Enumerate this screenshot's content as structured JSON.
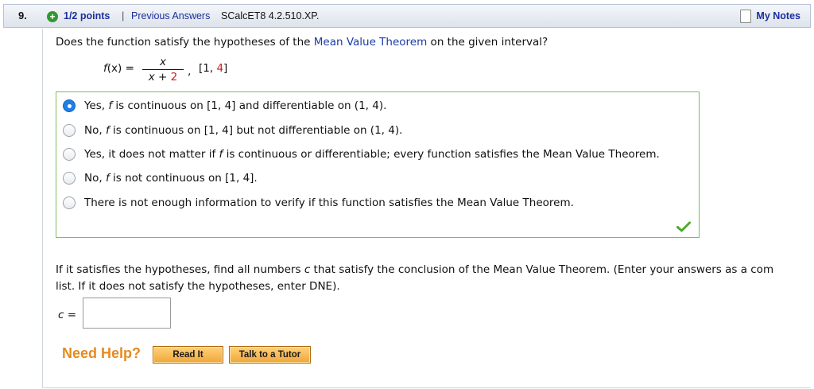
{
  "header": {
    "question_number": "9.",
    "points": "1/2 points",
    "separator": "|",
    "previous_answers": "Previous Answers",
    "problem_code": "SCalcET8 4.2.510.XP.",
    "my_notes": "My Notes"
  },
  "question": {
    "prefix": "Does the function satisfy the hypotheses of the ",
    "link": "Mean Value Theorem",
    "suffix": " on the given interval?"
  },
  "formula": {
    "lhs_f": "f",
    "lhs_rest": "(x) =",
    "numerator": "x",
    "den_var": "x",
    "den_plus": " + ",
    "den_const": "2",
    "comma": ",",
    "interval_open": "[1, ",
    "interval_end": "4",
    "interval_close": "]"
  },
  "choices": [
    {
      "pre": "Yes, ",
      "f": "f",
      "post": " is continuous on [1, 4] and differentiable on (1, 4).",
      "selected": true
    },
    {
      "pre": "No, ",
      "f": "f",
      "post": " is continuous on [1, 4] but not differentiable on (1, 4).",
      "selected": false
    },
    {
      "pre": "Yes, it does not matter if ",
      "f": "f",
      "post": " is continuous or differentiable; every function satisfies the Mean Value Theorem.",
      "selected": false
    },
    {
      "pre": "No, ",
      "f": "f",
      "post": " is not continuous on [1, 4].",
      "selected": false
    },
    {
      "pre": "There is not enough information to verify if this function satisfies the Mean Value Theorem.",
      "f": "",
      "post": "",
      "selected": false
    }
  ],
  "part2": {
    "line1_pre": "If it satisfies the hypotheses, find all numbers ",
    "line1_var": "c",
    "line1_post": " that satisfy the conclusion of the Mean Value Theorem. (Enter your answers as a com",
    "line2": "list. If it does not satisfy the hypotheses, enter DNE)."
  },
  "answer_field": {
    "label_var": "c",
    "label_eq": " =",
    "value": ""
  },
  "help": {
    "title": "Need Help?",
    "read_it": "Read It",
    "talk_to_tutor": "Talk to a Tutor"
  },
  "colors": {
    "link": "#1a2f9a",
    "correct_border": "#7bbd5c",
    "check": "#4caa2f",
    "help_orange": "#e58a1f",
    "selected_radio": "#1f7fe6",
    "highlight_red": "#c81e1e"
  }
}
